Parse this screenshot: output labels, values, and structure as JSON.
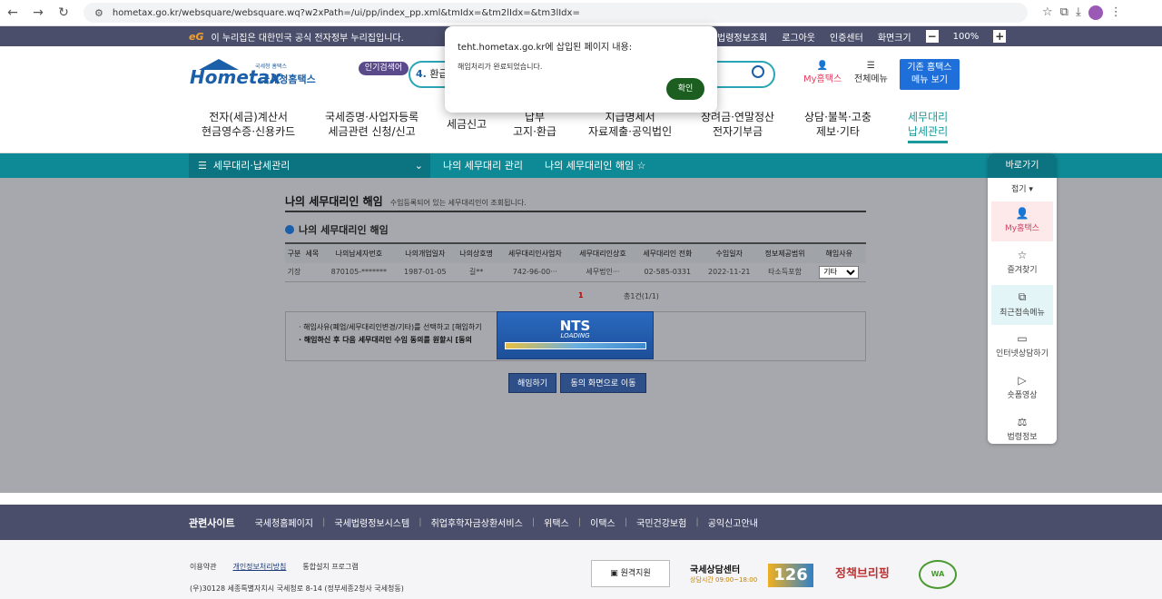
{
  "browser": {
    "url": "hometax.go.kr/websquare/websquare.wq?w2xPath=/ui/pp/index_pp.xml&tmIdx=&tm2lIdx=&tm3lIdx="
  },
  "topbar": {
    "eg": "eG",
    "gov_text": "이 누리집은 대한민국 공식 전자정부 누리집입니다.",
    "links": [
      "법령정보조회",
      "로그아웃",
      "인증센터",
      "화면크기"
    ],
    "zoom": "100%",
    "zoom_minus": "−",
    "zoom_plus": "+"
  },
  "header": {
    "logo_small": "국세청 홈택스",
    "logo_main": "Hometax",
    "logo_ko": "국세청홈택스",
    "popular_search": "인기검색어",
    "search_number": "4.",
    "search_text": "환급",
    "my_hometax": "My홈택스",
    "all_menu": "전체메뉴",
    "old_menu": [
      "기존 홈택스",
      "메뉴 보기"
    ]
  },
  "gnb": [
    [
      "전자(세금)계산서",
      "현금영수증·신용카드"
    ],
    [
      "국세증명·사업자등록",
      "세금관련 신청/신고"
    ],
    [
      "세금신고",
      ""
    ],
    [
      "납부",
      "고지·환급"
    ],
    [
      "지급명세서",
      "자료제출·공익법인"
    ],
    [
      "장려금·연말정산",
      "전자기부금"
    ],
    [
      "상담·불복·고충",
      "제보·기타"
    ],
    [
      "세무대리",
      "납세관리"
    ]
  ],
  "subbar": {
    "l1": "세무대리·납세관리",
    "l2": "나의 세무대리 관리",
    "l3": "나의 세무대리인 해임 ☆"
  },
  "page": {
    "title": "나의 세무대리인 해임",
    "title_note": "수임등록되어 있는 세무대리인이 조회됩니다.",
    "section": "나의 세무대리인 해임"
  },
  "table": {
    "headers": [
      "구분",
      "세목",
      "나의납세자번호",
      "나의개업일자",
      "나의상호명",
      "세무대리인사업자",
      "세무대리인상호",
      "세무대리인 전화",
      "수임일자",
      "정보제공범위",
      "해임사유"
    ],
    "row": [
      "기장",
      "",
      "870105-*******",
      "1987-01-05",
      "길**",
      "742-96-00···",
      "세무법인···",
      "02-585-0331",
      "2022-11-21",
      "타소득포함",
      "기타"
    ]
  },
  "pagination": {
    "current": "1",
    "count": "총1건(1/1)"
  },
  "notes": [
    "· 해임사유(폐업/세무대리인변경/기타)를 선택하고 [해임하기",
    "· 해임하신 후 다음 세무대리인 수임 동의를 원할시 [동의"
  ],
  "loading": {
    "nts": "NTS",
    "text": "LOADING"
  },
  "buttons": {
    "dismiss": "해임하기",
    "consent": "동의 화면으로 이동"
  },
  "quick": {
    "title": "바로가기",
    "fold": "접기 ▾",
    "items": [
      "My홈택스",
      "즐겨찾기",
      "최근접속메뉴",
      "인터넷상담하기",
      "숏폼영상",
      "법령정보"
    ]
  },
  "dialog": {
    "title": "teht.hometax.go.kr에 삽입된 페이지 내용:",
    "message": "해임처리가 완료되었습니다.",
    "ok": "확인"
  },
  "footer": {
    "related": "관련사이트",
    "sites": [
      "국세청홈페이지",
      "국세법령정보시스템",
      "취업후학자금상환서비스",
      "위택스",
      "이택스",
      "국민건강보험",
      "공익신고안내"
    ],
    "links": [
      "이용약관",
      "개인정보처리방침",
      "통합설치 프로그램"
    ],
    "address": "(우)30128 세종특별자치시 국세청로 8-14 (정부세종2청사 국세청동)",
    "remote": "원격지원",
    "center_title": "국세상담센터",
    "center_hours": "상담시간 09:00~18:00",
    "center_num": "126",
    "brief": "정책브리핑",
    "wa": "WA"
  }
}
